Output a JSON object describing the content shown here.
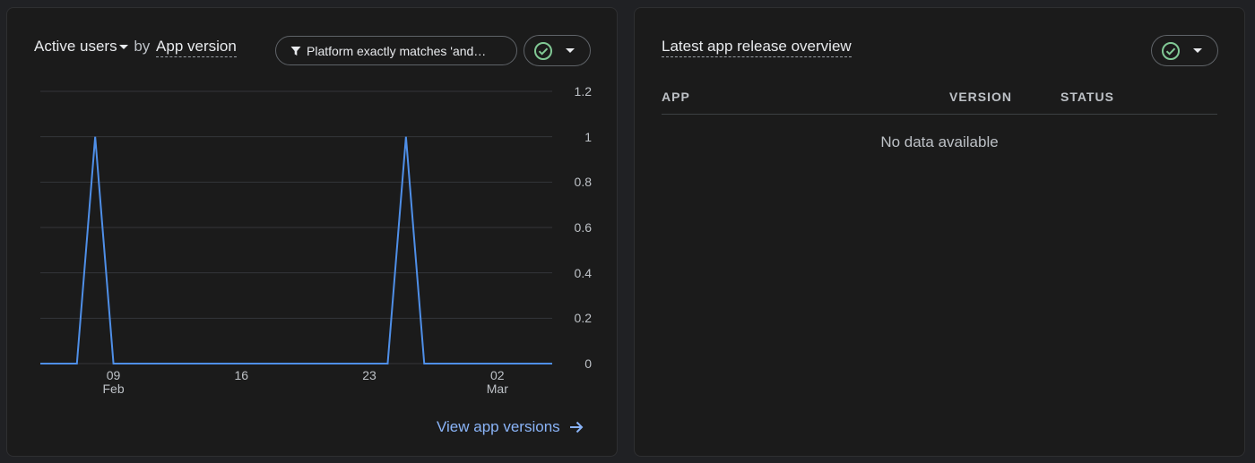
{
  "left_card": {
    "title_metric": "Active users",
    "title_by": "by",
    "title_dimension": "App version",
    "filter_label": "Platform exactly matches 'and…",
    "link_label": "View app versions"
  },
  "right_card": {
    "title": "Latest app release overview",
    "columns": [
      "APP",
      "VERSION",
      "STATUS"
    ],
    "empty_message": "No data available"
  },
  "colors": {
    "series": "#4f8fe8",
    "accent_link": "#8ab4f8",
    "status_ok": "#81c995"
  },
  "chart_data": {
    "type": "line",
    "x": [
      "Feb 05",
      "Feb 06",
      "Feb 07",
      "Feb 08",
      "Feb 09",
      "Feb 10",
      "Feb 11",
      "Feb 12",
      "Feb 13",
      "Feb 14",
      "Feb 15",
      "Feb 16",
      "Feb 17",
      "Feb 18",
      "Feb 19",
      "Feb 20",
      "Feb 21",
      "Feb 22",
      "Feb 23",
      "Feb 24",
      "Feb 25",
      "Feb 26",
      "Feb 27",
      "Feb 28",
      "Mar 01",
      "Mar 02",
      "Mar 03",
      "Mar 04",
      "Mar 05"
    ],
    "series": [
      {
        "values": [
          0,
          0,
          0,
          1,
          0,
          0,
          0,
          0,
          0,
          0,
          0,
          0,
          0,
          0,
          0,
          0,
          0,
          0,
          0,
          0,
          1,
          0,
          0,
          0,
          0,
          0,
          0,
          0,
          0
        ]
      }
    ],
    "y_ticks": [
      "1.2",
      "1",
      "0.8",
      "0.6",
      "0.4",
      "0.2",
      "0"
    ],
    "x_ticks": [
      {
        "day": "09",
        "month": "Feb"
      },
      {
        "day": "16",
        "month": ""
      },
      {
        "day": "23",
        "month": ""
      },
      {
        "day": "02",
        "month": "Mar"
      }
    ],
    "ylim": [
      0,
      1.2
    ],
    "grid": true
  }
}
